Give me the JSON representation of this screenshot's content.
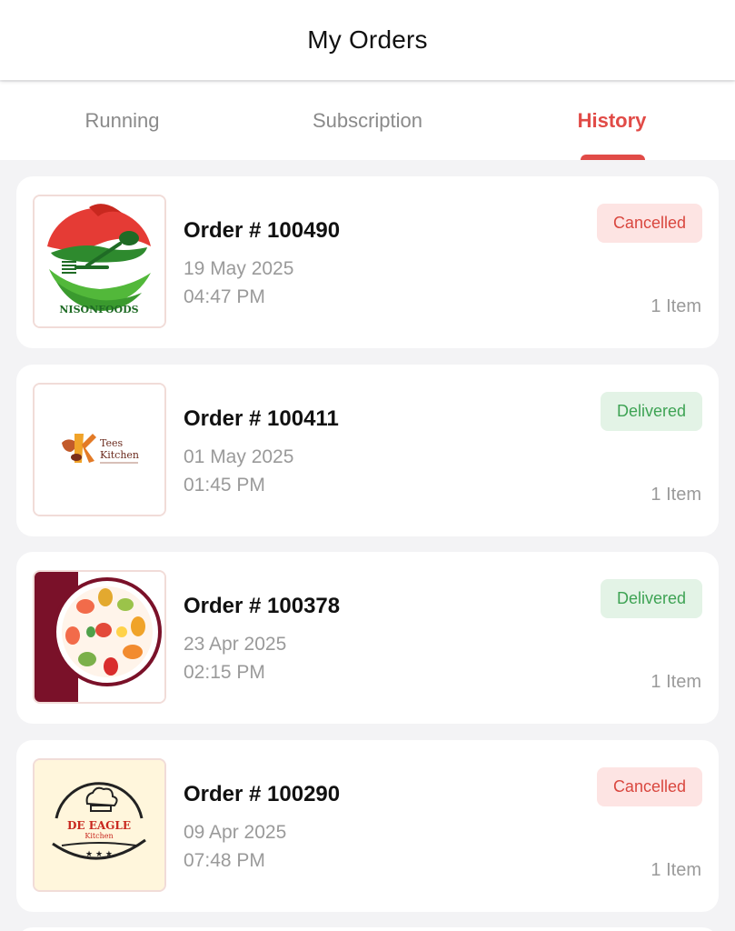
{
  "header": {
    "title": "My Orders"
  },
  "tabs": [
    {
      "label": "Running",
      "active": false
    },
    {
      "label": "Subscription",
      "active": false
    },
    {
      "label": "History",
      "active": true
    }
  ],
  "colors": {
    "accent": "#e14b47",
    "cancelled_bg": "#fde4e3",
    "cancelled_text": "#d9473f",
    "delivered_bg": "#e3f3e6",
    "delivered_text": "#3ea354"
  },
  "orders": [
    {
      "order_no": "Order # 100490",
      "date": "19 May 2025",
      "time": "04:47 PM",
      "status": "Cancelled",
      "items": "1 Item",
      "logo": "nisonfoods-logo",
      "logo_text": "NISONFOODS"
    },
    {
      "order_no": "Order # 100411",
      "date": "01 May 2025",
      "time": "01:45 PM",
      "status": "Delivered",
      "items": "1 Item",
      "logo": "tees-kitchen-logo",
      "logo_text": "Tees Kitchen"
    },
    {
      "order_no": "Order # 100378",
      "date": "23 Apr 2025",
      "time": "02:15 PM",
      "status": "Delivered",
      "items": "1 Item",
      "logo": "salad-plate-logo"
    },
    {
      "order_no": "Order # 100290",
      "date": "09 Apr 2025",
      "time": "07:48 PM",
      "status": "Cancelled",
      "items": "1 Item",
      "logo": "de-eagle-kitchen-logo",
      "logo_text": "DE EAGLE Kitchen"
    }
  ]
}
